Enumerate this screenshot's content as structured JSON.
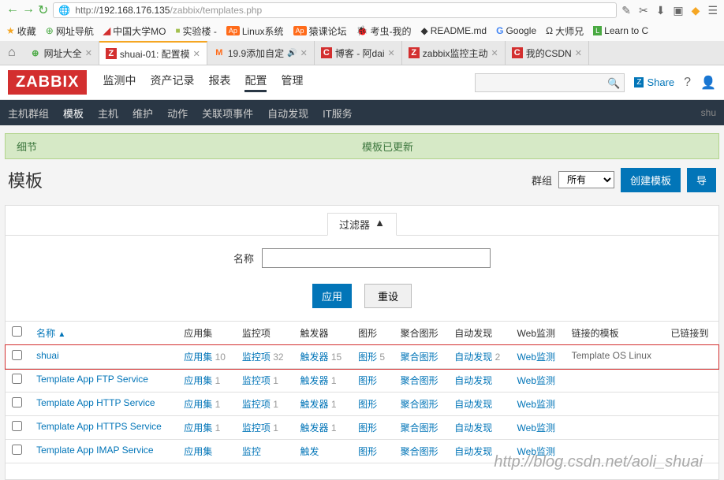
{
  "browser": {
    "url_host": "192.168.176.135",
    "url_path": "/zabbix/templates.php",
    "bookmarks": [
      "收藏",
      "网址导航",
      "中国大学MO",
      "实验楼 -",
      "Linux系统",
      "猿课论坛",
      "考虫-我的",
      "README.md",
      "Google",
      "大师兄",
      "Learn to C"
    ],
    "tabs": [
      {
        "label": "网址大全",
        "active": false
      },
      {
        "label": "shuai-01: 配置模",
        "active": true,
        "favicon": "Z"
      },
      {
        "label": "19.9添加自定",
        "active": false,
        "sound": true,
        "favicon": "M"
      },
      {
        "label": "博客 - 阿dai",
        "active": false,
        "favicon": "C"
      },
      {
        "label": "zabbix监控主动",
        "active": false,
        "favicon": "Z"
      },
      {
        "label": "我的CSDN",
        "active": false,
        "favicon": "C"
      }
    ]
  },
  "zabbix": {
    "logo": "ZABBIX",
    "mainnav": [
      "监测中",
      "资产记录",
      "报表",
      "配置",
      "管理"
    ],
    "mainnav_active": 3,
    "share": "Share",
    "subnav": [
      "主机群组",
      "模板",
      "主机",
      "维护",
      "动作",
      "关联项事件",
      "自动发现",
      "IT服务"
    ],
    "subnav_active": 1,
    "subnav_right": "shu",
    "status": {
      "left": "细节",
      "right": "模板已更新"
    },
    "title": "模板",
    "group_label": "群组",
    "group_value": "所有",
    "create_btn": "创建模板",
    "import_btn": "导",
    "filter": {
      "tab": "过滤器",
      "name_label": "名称",
      "apply": "应用",
      "reset": "重设",
      "name_value": ""
    },
    "columns": [
      "",
      "名称",
      "应用集",
      "监控项",
      "触发器",
      "图形",
      "聚合图形",
      "自动发现",
      "Web监测",
      "链接的模板",
      "已链接到"
    ],
    "rows": [
      {
        "name": "shuai",
        "app": "应用集",
        "app_n": "10",
        "items": "监控项",
        "items_n": "32",
        "trig": "触发器",
        "trig_n": "15",
        "graph": "图形",
        "graph_n": "5",
        "screen": "聚合图形",
        "disc": "自动发现",
        "disc_n": "2",
        "web": "Web监测",
        "linked": "Template OS Linux",
        "highlight": true
      },
      {
        "name": "Template App FTP Service",
        "app": "应用集",
        "app_n": "1",
        "items": "监控项",
        "items_n": "1",
        "trig": "触发器",
        "trig_n": "1",
        "graph": "图形",
        "screen": "聚合图形",
        "disc": "自动发现",
        "web": "Web监测"
      },
      {
        "name": "Template App HTTP Service",
        "app": "应用集",
        "app_n": "1",
        "items": "监控项",
        "items_n": "1",
        "trig": "触发器",
        "trig_n": "1",
        "graph": "图形",
        "screen": "聚合图形",
        "disc": "自动发现",
        "web": "Web监测"
      },
      {
        "name": "Template App HTTPS Service",
        "app": "应用集",
        "app_n": "1",
        "items": "监控项",
        "items_n": "1",
        "trig": "触发器",
        "trig_n": "1",
        "graph": "图形",
        "screen": "聚合图形",
        "disc": "自动发现",
        "web": "Web监测"
      },
      {
        "name": "Template App IMAP Service",
        "app": "应用集",
        "items": "监控",
        "trig": "触发",
        "graph": "图形",
        "screen": "聚合图形",
        "disc": "自动发现",
        "web": "Web监测"
      }
    ],
    "watermark": "http://blog.csdn.net/aoli_shuai"
  }
}
